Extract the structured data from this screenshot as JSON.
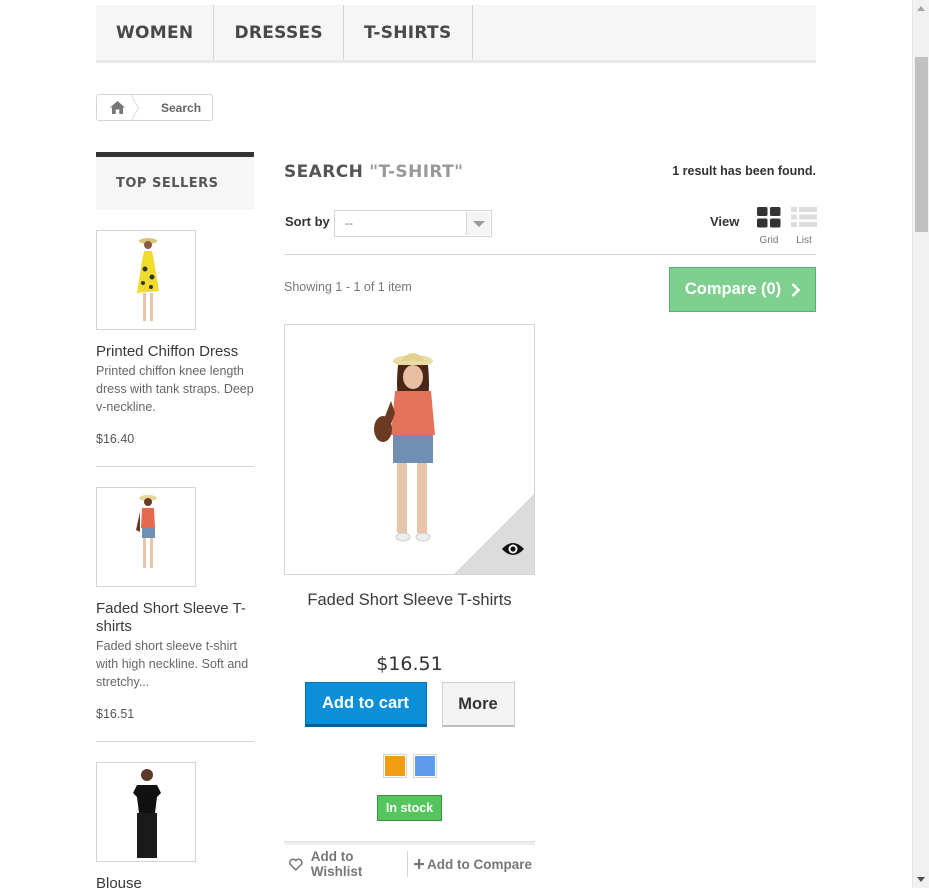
{
  "topmenu": {
    "items": [
      "WOMEN",
      "DRESSES",
      "T-SHIRTS"
    ]
  },
  "breadcrumb": {
    "current": "Search"
  },
  "sidebar": {
    "title": "TOP SELLERS",
    "items": [
      {
        "name": "Printed Chiffon Dress",
        "desc": "Printed chiffon knee length dress with tank straps. Deep v-neckline.",
        "price": "$16.40"
      },
      {
        "name": "Faded Short Sleeve T-shirts",
        "desc": "Faded short sleeve t-shirt with high neckline. Soft and stretchy...",
        "price": "$16.51"
      },
      {
        "name": "Blouse"
      }
    ]
  },
  "search": {
    "label": "SEARCH",
    "query": "\"T-SHIRT\"",
    "result_count": "1 result has been found."
  },
  "sort": {
    "label": "Sort by",
    "value": "--"
  },
  "view": {
    "label": "View",
    "grid": "Grid",
    "list": "List"
  },
  "showing": "Showing 1 - 1 of 1 item",
  "compare": {
    "label": "Compare (0)"
  },
  "product": {
    "name": "Faded Short Sleeve T-shirts",
    "price": "$16.51",
    "add_to_cart": "Add to cart",
    "more": "More",
    "colors": [
      "#f39c11",
      "#5d9cec"
    ],
    "stock": "In stock",
    "wishlist": "Add to Wishlist",
    "add_compare": "Add to Compare"
  }
}
